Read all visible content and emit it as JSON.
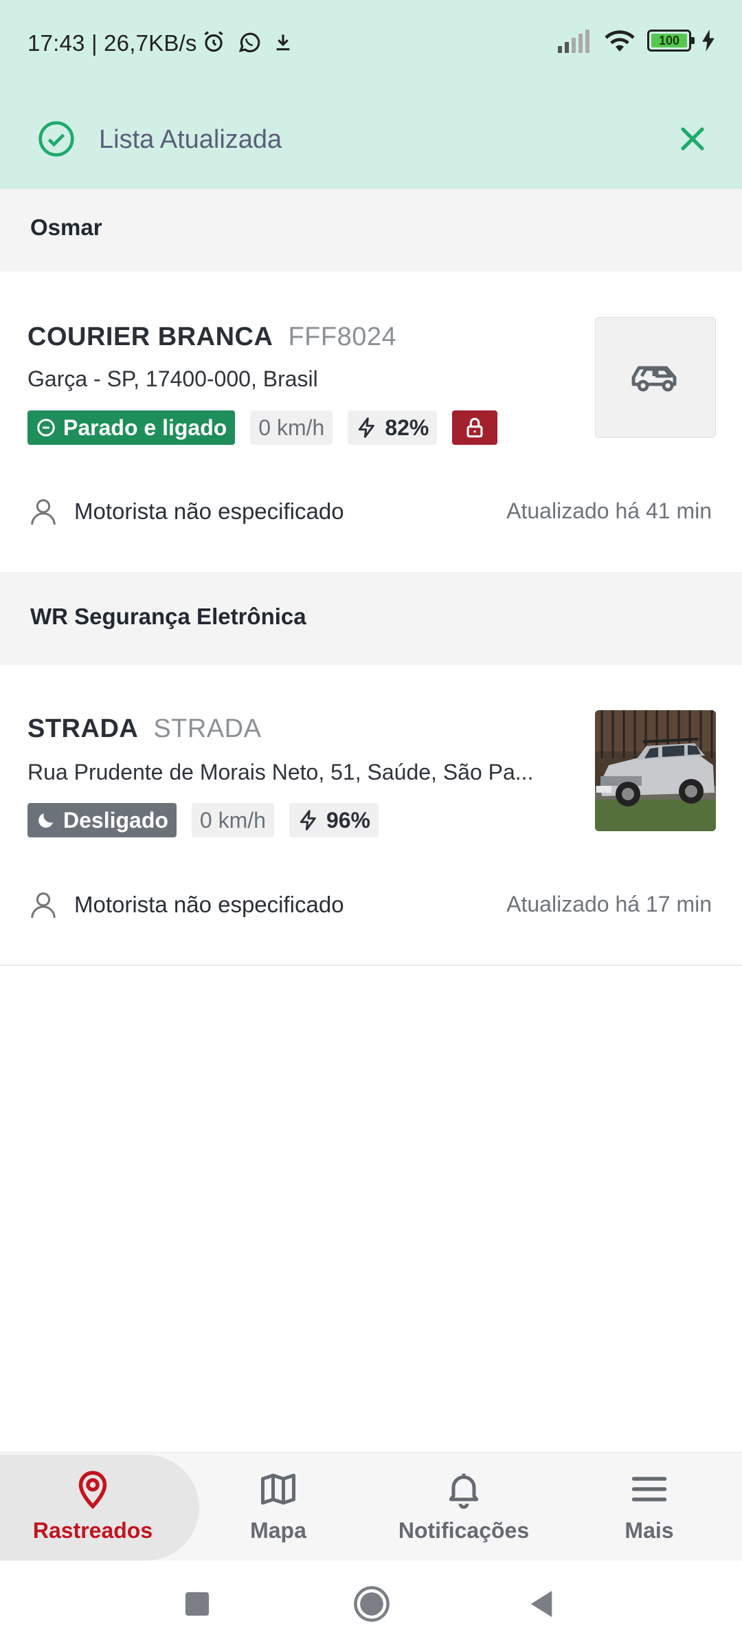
{
  "status_bar": {
    "time_speed": "17:43 | 26,7KB/s",
    "battery": "100"
  },
  "banner": {
    "text": "Lista Atualizada"
  },
  "groups": [
    {
      "title": "Osmar",
      "vehicle": {
        "name": "COURIER BRANCA",
        "plate": "FFF8024",
        "address": "Garça - SP, 17400-000, Brasil",
        "status": "Parado e ligado",
        "speed": "0 km/h",
        "battery": "82%",
        "driver": "Motorista não especificado",
        "updated": "Atualizado há 41 min"
      }
    },
    {
      "title": "WR Segurança Eletrônica",
      "vehicle": {
        "name": "STRADA",
        "plate": "STRADA",
        "address": "Rua Prudente de Morais Neto, 51, Saúde, São Pa...",
        "status": "Desligado",
        "speed": "0 km/h",
        "battery": "96%",
        "driver": "Motorista não especificado",
        "updated": "Atualizado há 17 min"
      }
    }
  ],
  "bottom_nav": [
    {
      "label": "Rastreados",
      "icon": "location-pin-icon",
      "active": true
    },
    {
      "label": "Mapa",
      "icon": "map-icon",
      "active": false
    },
    {
      "label": "Notificações",
      "icon": "bell-icon",
      "active": false
    },
    {
      "label": "Mais",
      "icon": "menu-icon",
      "active": false
    }
  ],
  "colors": {
    "banner_bg": "#d2efe6",
    "accent_green": "#1e8e5a",
    "accent_red": "#c2141f",
    "lock_red": "#a3202d"
  }
}
